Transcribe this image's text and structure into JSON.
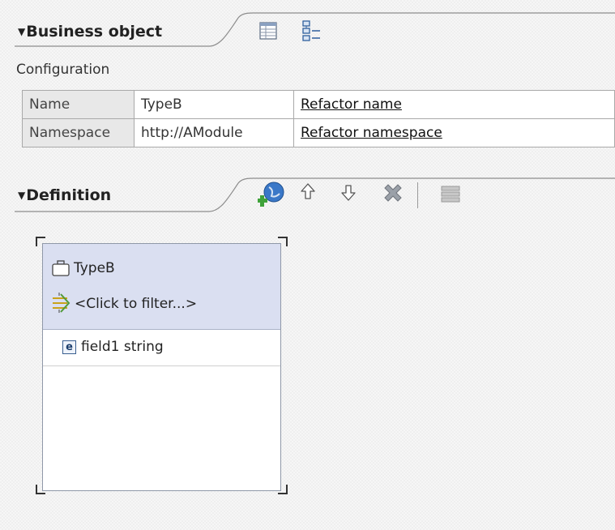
{
  "business_object": {
    "section_title": "Business object",
    "toolbar_icons": [
      "table-view-icon",
      "tree-view-icon"
    ],
    "configuration_label": "Configuration",
    "rows": [
      {
        "key": "Name",
        "value": "TypeB",
        "action": "Refactor name"
      },
      {
        "key": "Namespace",
        "value": "http://AModule",
        "action": "Refactor namespace"
      }
    ]
  },
  "definition": {
    "section_title": "Definition",
    "toolbar_icons": [
      "add-field-icon",
      "move-up-icon",
      "move-down-icon",
      "delete-icon",
      "properties-icon"
    ],
    "object_name": "TypeB",
    "filter_text": "<Click to filter...>",
    "fields": [
      {
        "badge": "e",
        "label": "field1 string"
      }
    ]
  },
  "colors": {
    "header_fill": "#dadff1",
    "link_text": "#111111",
    "add_icon_blue": "#3a78c8",
    "add_icon_green": "#3fa23a",
    "delete_icon": "#8a8f99"
  }
}
